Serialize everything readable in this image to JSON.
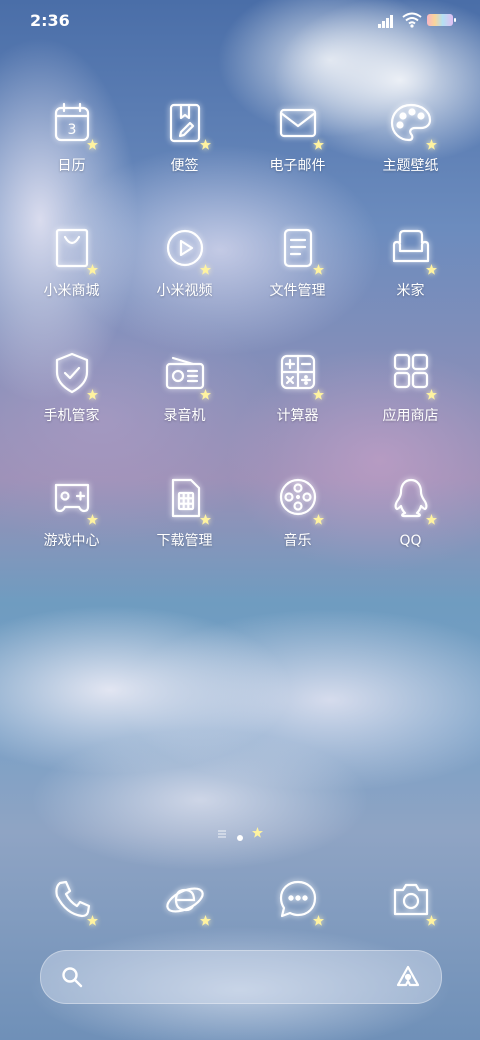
{
  "status_bar": {
    "time": "2:36",
    "signal_icon": "signal-bars-icon",
    "wifi_icon": "wifi-icon",
    "battery_icon": "battery-icon"
  },
  "apps": [
    {
      "label": "日历",
      "icon": "calendar-icon",
      "calendar_day": "3"
    },
    {
      "label": "便签",
      "icon": "notes-icon"
    },
    {
      "label": "电子邮件",
      "icon": "mail-icon"
    },
    {
      "label": "主题壁纸",
      "icon": "palette-icon"
    },
    {
      "label": "小米商城",
      "icon": "shopping-bag-icon"
    },
    {
      "label": "小米视频",
      "icon": "video-play-icon"
    },
    {
      "label": "文件管理",
      "icon": "file-icon"
    },
    {
      "label": "米家",
      "icon": "sofa-icon"
    },
    {
      "label": "手机管家",
      "icon": "shield-check-icon"
    },
    {
      "label": "录音机",
      "icon": "radio-recorder-icon"
    },
    {
      "label": "计算器",
      "icon": "calculator-icon"
    },
    {
      "label": "应用商店",
      "icon": "app-store-icon"
    },
    {
      "label": "游戏中心",
      "icon": "gamepad-icon"
    },
    {
      "label": "下载管理",
      "icon": "download-sim-icon"
    },
    {
      "label": "音乐",
      "icon": "film-reel-icon"
    },
    {
      "label": "QQ",
      "icon": "qq-penguin-icon"
    }
  ],
  "page_indicator": {
    "pages": 3,
    "current": 2
  },
  "dock": [
    {
      "icon": "phone-icon"
    },
    {
      "icon": "browser-icon"
    },
    {
      "icon": "messages-icon"
    },
    {
      "icon": "camera-icon"
    }
  ],
  "search_bar": {
    "search_icon": "search-icon",
    "assistant_icon": "assistant-icon"
  },
  "colors": {
    "glow": "#ffffff",
    "star": "#fff3a0"
  }
}
